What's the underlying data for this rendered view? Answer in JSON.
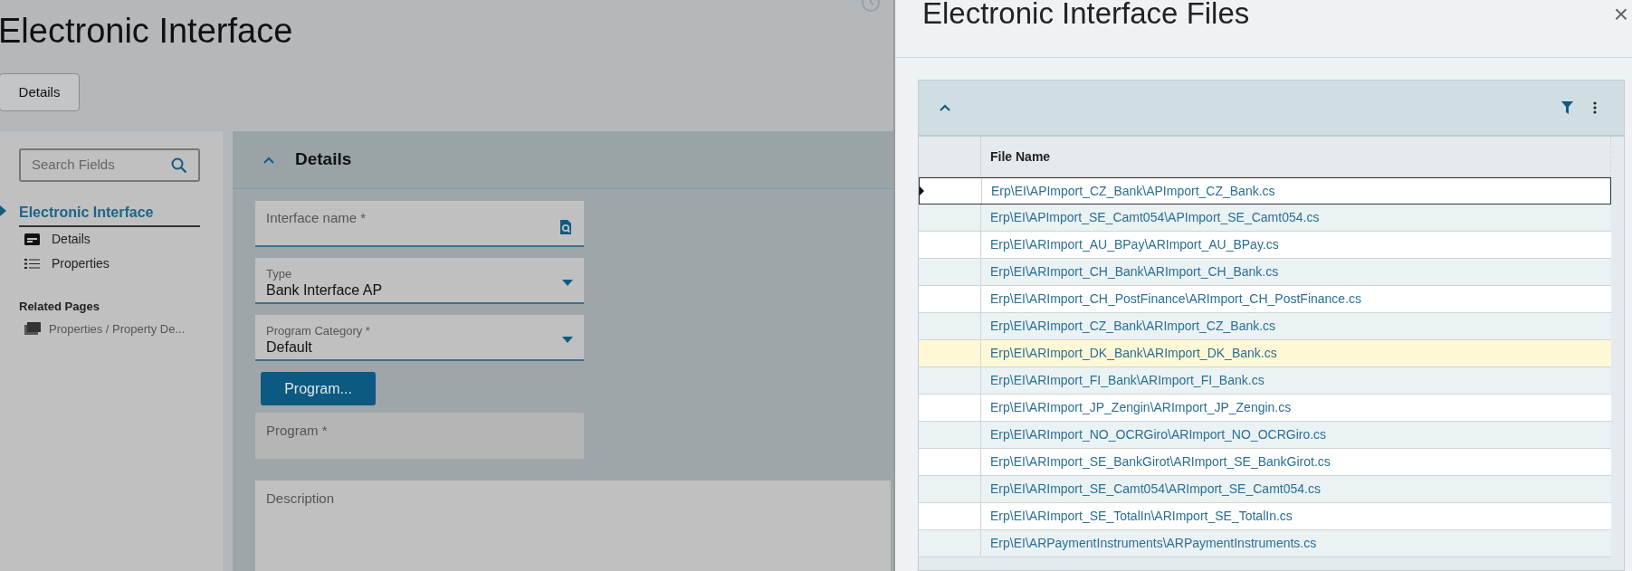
{
  "page": {
    "title": "Electronic Interface",
    "tab_button": "Details"
  },
  "sidebar": {
    "search": {
      "placeholder": "Search Fields"
    },
    "nav": {
      "label": "Electronic Interface",
      "expanded": true,
      "children": [
        {
          "label": "Details",
          "kind": "card"
        },
        {
          "label": "Properties",
          "kind": "list"
        }
      ]
    },
    "related_heading": "Related Pages",
    "related": [
      {
        "label": "Properties / Property De..."
      }
    ]
  },
  "details": {
    "title": "Details",
    "expanded": true,
    "fields": [
      {
        "kind": "lookup",
        "label": "Interface name *"
      },
      {
        "kind": "select",
        "label": "Type",
        "value": "Bank Interface AP"
      },
      {
        "kind": "select",
        "label": "Program Category *",
        "value": "Default"
      },
      {
        "kind": "button",
        "label": "Program..."
      },
      {
        "kind": "readonly",
        "label": "Program *"
      },
      {
        "kind": "textarea",
        "label": "Description"
      }
    ]
  },
  "files_panel": {
    "title": "Electronic Interface Files",
    "close": "×",
    "expanded": true,
    "table": {
      "columns": [
        "File Name"
      ],
      "rows": [
        {
          "file": "Erp\\EI\\APImport_CZ_Bank\\APImport_CZ_Bank.cs",
          "selected": true,
          "highlighted": false
        },
        {
          "file": "Erp\\EI\\APImport_SE_Camt054\\APImport_SE_Camt054.cs",
          "selected": false,
          "highlighted": false
        },
        {
          "file": "Erp\\EI\\ARImport_AU_BPay\\ARImport_AU_BPay.cs",
          "selected": false,
          "highlighted": false
        },
        {
          "file": "Erp\\EI\\ARImport_CH_Bank\\ARImport_CH_Bank.cs",
          "selected": false,
          "highlighted": false
        },
        {
          "file": "Erp\\EI\\ARImport_CH_PostFinance\\ARImport_CH_PostFinance.cs",
          "selected": false,
          "highlighted": false
        },
        {
          "file": "Erp\\EI\\ARImport_CZ_Bank\\ARImport_CZ_Bank.cs",
          "selected": false,
          "highlighted": false
        },
        {
          "file": "Erp\\EI\\ARImport_DK_Bank\\ARImport_DK_Bank.cs",
          "selected": false,
          "highlighted": true
        },
        {
          "file": "Erp\\EI\\ARImport_FI_Bank\\ARImport_FI_Bank.cs",
          "selected": false,
          "highlighted": false
        },
        {
          "file": "Erp\\EI\\ARImport_JP_Zengin\\ARImport_JP_Zengin.cs",
          "selected": false,
          "highlighted": false
        },
        {
          "file": "Erp\\EI\\ARImport_NO_OCRGiro\\ARImport_NO_OCRGiro.cs",
          "selected": false,
          "highlighted": false
        },
        {
          "file": "Erp\\EI\\ARImport_SE_BankGirot\\ARImport_SE_BankGirot.cs",
          "selected": false,
          "highlighted": false
        },
        {
          "file": "Erp\\EI\\ARImport_SE_Camt054\\ARImport_SE_Camt054.cs",
          "selected": false,
          "highlighted": false
        },
        {
          "file": "Erp\\EI\\ARImport_SE_TotalIn\\ARImport_SE_TotalIn.cs",
          "selected": false,
          "highlighted": false
        },
        {
          "file": "Erp\\EI\\ARPaymentInstruments\\ARPaymentInstruments.cs",
          "selected": false,
          "highlighted": false
        }
      ]
    }
  }
}
